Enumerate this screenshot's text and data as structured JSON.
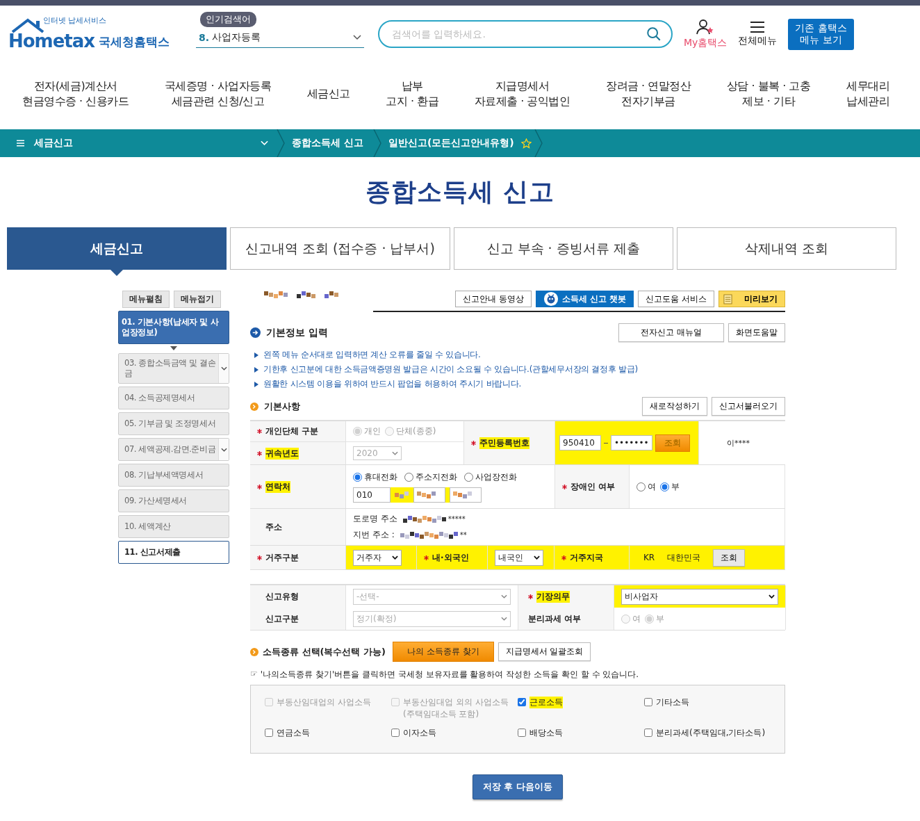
{
  "header": {
    "logo_tagline": "인터넷 납세서비스",
    "logo_text": "Hometax",
    "logo_name": "국세청홈택스",
    "popular_badge": "인기검색어",
    "popular_rank": "8.",
    "popular_term": "사업자등록",
    "search_placeholder": "검색어를 입력하세요.",
    "my_label": "My홈택스",
    "menu_label": "전체메뉴",
    "classic_button": [
      "기존 홈택스",
      "메뉴 보기"
    ]
  },
  "nav": [
    {
      "lines": [
        "전자(세금)계산서",
        "현금영수증 · 신용카드"
      ]
    },
    {
      "lines": [
        "국세증명 · 사업자등록",
        "세금관련 신청/신고"
      ]
    },
    {
      "lines": [
        "세금신고"
      ]
    },
    {
      "lines": [
        "납부",
        "고지 · 환급"
      ]
    },
    {
      "lines": [
        "지급명세서",
        "자료제출 · 공익법인"
      ]
    },
    {
      "lines": [
        "장려금 · 연말정산",
        "전자기부금"
      ]
    },
    {
      "lines": [
        "상담 · 불복 · 고충",
        "제보 · 기타"
      ]
    },
    {
      "lines": [
        "세무대리",
        "납세관리"
      ]
    }
  ],
  "breadcrumb": {
    "items": [
      "세금신고",
      "종합소득세 신고",
      "일반신고(모든신고안내유형)"
    ],
    "favorite": false
  },
  "page_title": "종합소득세 신고",
  "tabs": [
    {
      "label": "세금신고",
      "selected": true
    },
    {
      "label": "신고내역 조회 (접수증 · 납부서)",
      "selected": false
    },
    {
      "label": "신고 부속 · 증빙서류 제출",
      "selected": false
    },
    {
      "label": "삭제내역 조회",
      "selected": false
    }
  ],
  "sidebar": {
    "buttons": [
      "메뉴펼침",
      "메뉴접기"
    ],
    "items": [
      {
        "label": "01. 기본사항(납세자 및 사업장정보)",
        "selected": true,
        "submenu": false,
        "kind": "step"
      },
      {
        "label": "03. 종합소득금액 및 결손금",
        "selected": false,
        "submenu": true,
        "kind": "step"
      },
      {
        "label": "04. 소득공제명세서",
        "selected": false,
        "submenu": false,
        "kind": "step"
      },
      {
        "label": "05. 기부금 및 조정명세서",
        "selected": false,
        "submenu": false,
        "kind": "step"
      },
      {
        "label": "07. 세액공제.감면.준비금",
        "selected": false,
        "submenu": true,
        "kind": "step"
      },
      {
        "label": "08. 기납부세액명세서",
        "selected": false,
        "submenu": false,
        "kind": "step"
      },
      {
        "label": "09. 가산세명세서",
        "selected": false,
        "submenu": false,
        "kind": "step"
      },
      {
        "label": "10. 세액계산",
        "selected": false,
        "submenu": false,
        "kind": "step"
      },
      {
        "label": "11. 신고서제출",
        "selected": false,
        "submenu": false,
        "kind": "submit"
      }
    ]
  },
  "toolbar": [
    {
      "label": "신고안내 동영상",
      "kind": "default"
    },
    {
      "label": "소득세 신고 챗봇",
      "kind": "chatbot"
    },
    {
      "label": "신고도움 서비스",
      "kind": "default"
    },
    {
      "label": "미리보기",
      "kind": "preview"
    }
  ],
  "basic_info": {
    "title": "기본정보 입력",
    "buttons": [
      "전자신고 매뉴얼",
      "화면도움말"
    ],
    "notes": [
      "왼쪽 메뉴 순서대로 입력하면 계산 오류를 줄일 수 있습니다.",
      "기한후 신고분에 대한 소득금액증명원 발급은 시간이 소요될 수 있습니다.(관할세무서장의 결정후 발급)",
      "원활한 시스템 이용을 위하여 반드시 팝업을 허용하여 주시기 바랍니다."
    ]
  },
  "basics": {
    "title": "기본사항",
    "buttons": [
      "새로작성하기",
      "신고서불러오기"
    ],
    "entity_type": {
      "label": "개인단체 구분",
      "required": true,
      "disabled": true,
      "options": [
        {
          "label": "개인",
          "selected": true
        },
        {
          "label": "단체(종중)",
          "selected": false
        }
      ]
    },
    "year": {
      "label": "귀속년도",
      "required": true,
      "value": "2020",
      "disabled": true,
      "highlighted": true
    },
    "rrn": {
      "label": "주민등록번호",
      "required": true,
      "front": "950410",
      "back": "•••••••",
      "lookup": "조회",
      "name": "이****",
      "highlighted": true
    },
    "contact": {
      "label": "연락처",
      "required": true,
      "options": [
        {
          "label": "휴대전화",
          "selected": true
        },
        {
          "label": "주소지전화",
          "selected": false
        },
        {
          "label": "사업장전화",
          "selected": false
        }
      ],
      "prefix": "010",
      "highlighted": true
    },
    "disability": {
      "label": "장애인 여부",
      "required": true,
      "options": [
        {
          "label": "여",
          "selected": false
        },
        {
          "label": "부",
          "selected": true
        }
      ]
    },
    "address": {
      "label": "주소",
      "road_label": "도로명 주소",
      "road_tail": "*****",
      "lot_label": "지번 주소 :",
      "lot_tail": "**"
    },
    "residency": {
      "label": "거주구분",
      "required": true,
      "value": "거주자",
      "highlighted": true
    },
    "nationality": {
      "label": "내·외국인",
      "required": true,
      "value": "내국인",
      "highlighted": true
    },
    "country": {
      "label": "거주지국",
      "required": true,
      "code": "KR",
      "name": "대한민국",
      "lookup": "조회",
      "highlighted": true
    }
  },
  "filing": {
    "type": {
      "label": "신고유형",
      "placeholder": "-선택-"
    },
    "bookkeeping": {
      "label": "기장의무",
      "required": true,
      "value": "비사업자",
      "highlighted": true
    },
    "category": {
      "label": "신고구분",
      "value": "정기(확정)",
      "disabled": true
    },
    "separate_tax": {
      "label": "분리과세 여부",
      "disabled": true,
      "options": [
        {
          "label": "여",
          "selected": false
        },
        {
          "label": "부",
          "selected": true
        }
      ]
    }
  },
  "income": {
    "title": "소득종류 선택(복수선택 가능)",
    "find_button": "나의 소득종류 찾기",
    "bulk_button": "지급명세서 일괄조회",
    "hint_icon": "☞",
    "hint": "'나의소득종류 찾기'버튼을 클릭하면 국세청 보유자료를 활용하여 작성한 소득을 확인 할 수 있습니다.",
    "items": [
      {
        "label": "부동산임대업의 사업소득",
        "checked": false,
        "disabled": true,
        "highlighted": false
      },
      {
        "label": "부동산임대업 외의 사업소득",
        "sub": "(주택임대소득 포함)",
        "checked": false,
        "disabled": true,
        "highlighted": false
      },
      {
        "label": "근로소득",
        "checked": true,
        "disabled": false,
        "highlighted": true
      },
      {
        "label": "기타소득",
        "checked": false,
        "disabled": false,
        "highlighted": false
      },
      {
        "label": "연금소득",
        "checked": false,
        "disabled": false,
        "highlighted": false
      },
      {
        "label": "이자소득",
        "checked": false,
        "disabled": false,
        "highlighted": false
      },
      {
        "label": "배당소득",
        "checked": false,
        "disabled": false,
        "highlighted": false
      },
      {
        "label": "분리과세(주택임대,기타소득)",
        "checked": false,
        "disabled": false,
        "highlighted": false
      }
    ]
  },
  "save_button": "저장 후 다음이동"
}
